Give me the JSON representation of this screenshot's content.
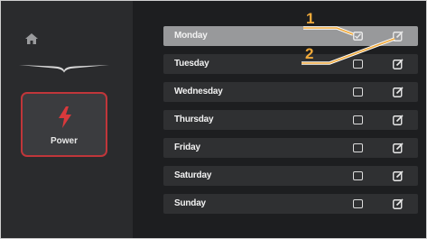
{
  "sidebar": {
    "home_icon": "home-icon",
    "logo": "brand-logo",
    "power": {
      "label": "Power",
      "icon": "lightning-bolt-icon"
    }
  },
  "days": [
    {
      "label": "Monday",
      "checked": true,
      "selected": true
    },
    {
      "label": "Tuesday",
      "checked": false,
      "selected": false
    },
    {
      "label": "Wednesday",
      "checked": false,
      "selected": false
    },
    {
      "label": "Thursday",
      "checked": false,
      "selected": false
    },
    {
      "label": "Friday",
      "checked": false,
      "selected": false
    },
    {
      "label": "Saturday",
      "checked": false,
      "selected": false
    },
    {
      "label": "Sunday",
      "checked": false,
      "selected": false
    }
  ],
  "annotations": {
    "callout_1": "1",
    "callout_2": "2"
  },
  "colors": {
    "background": "#1d1e20",
    "sidebar": "#2a2b2d",
    "row": "#2f3032",
    "row_selected": "#98999b",
    "power_accent": "#c0363a",
    "callout": "#f0a93a"
  }
}
